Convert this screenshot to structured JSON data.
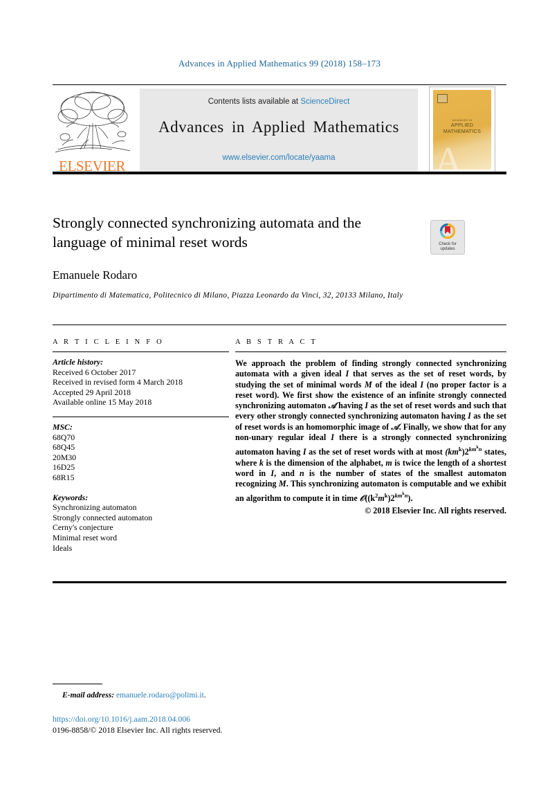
{
  "running_head": "Advances in Applied Mathematics 99 (2018) 158–173",
  "masthead": {
    "contents_prefix": "Contents lists available at ",
    "sciencedirect": "ScienceDirect",
    "journal_name": "Advances in Applied Mathematics",
    "journal_url": "www.elsevier.com/locate/yaama",
    "publisher_wordmark": "ELSEVIER",
    "cover": {
      "line1": "ADVANCES IN",
      "line2": "APPLIED",
      "line3": "MATHEMATICS",
      "big_letter": "A"
    },
    "colors": {
      "elsevier_orange": "#ee7624",
      "link_blue": "#2a7fb8",
      "contents_bg": "#e8e8e8",
      "cover_gold": "#e4b149"
    }
  },
  "article": {
    "title": "Strongly connected synchronizing automata and the language of minimal reset words",
    "author": "Emanuele Rodaro",
    "affiliation": "Dipartimento di Matematica, Politecnico di Milano, Piazza Leonardo da Vinci, 32, 20133 Milano, Italy",
    "crossmark": {
      "line1": "Check for",
      "line2": "updates"
    }
  },
  "info": {
    "heading": "A R T I C L E   I N F O",
    "history_label": "Article history:",
    "history": [
      "Received 6 October 2017",
      "Received in revised form 4 March 2018",
      "Accepted 29 April 2018",
      "Available online 15 May 2018"
    ],
    "msc_label": "MSC:",
    "msc": [
      "68Q70",
      "68Q45",
      "20M30",
      "16D25",
      "68R15"
    ],
    "keywords_label": "Keywords:",
    "keywords": [
      "Synchronizing automaton",
      "Strongly connected automaton",
      "Cerny's conjecture",
      "Minimal reset word",
      "Ideals"
    ]
  },
  "abstract": {
    "heading": "A B S T R A C T",
    "part1": "We approach the problem of finding strongly connected synchronizing automata with a given ideal ",
    "ideal_I": "I",
    "part2": " that serves as the set of reset words, by studying the set of minimal words ",
    "minimal_M": "M",
    "part3": " of the ideal ",
    "part4": " (no proper factor is a reset word). We first show the existence of an infinite strongly connected synchronizing automaton ",
    "automaton_A": "𝒜",
    "part5": " having ",
    "part6": " as the set of reset words and such that every other strongly connected synchronizing automaton having ",
    "part7": " as the set of reset words is an homomorphic image of ",
    "part8": ". Finally, we show that for any non-unary regular ideal ",
    "part9": " there is a strongly connected synchronizing automaton having ",
    "part10": " as the set of reset words with at most ",
    "formula_states_base": "(km",
    "formula_states_exp1": "k",
    "formula_states_mid": ")2",
    "formula_states_exp2": "km",
    "formula_states_exp2b": "k",
    "formula_states_exp2c": "n",
    "part11": " states, where ",
    "var_k": "k",
    "part12": " is the dimension of the alphabet, ",
    "var_m": "m",
    "part13": " is twice the length of a shortest word in ",
    "part14": ", and ",
    "var_n": "n",
    "part15": " is the number of states of the smallest automaton recognizing ",
    "part16": ". This synchronizing automaton is computable and we exhibit an algorithm to compute it in time ",
    "complexity_O": "𝒪",
    "complexity_base": "((k",
    "complexity_exp_2": "2",
    "complexity_m": "m",
    "complexity_exp_k": "k",
    "complexity_mid": ")2",
    "complexity_exp2": "km",
    "complexity_exp2b": "k",
    "complexity_exp2c": "n",
    "complexity_tail": ").",
    "copyright": "© 2018 Elsevier Inc. All rights reserved."
  },
  "footer": {
    "email_label": "E-mail address:",
    "email": "emanuele.rodaro@polimi.it",
    "email_period": ".",
    "doi": "https://doi.org/10.1016/j.aam.2018.04.006",
    "issn_line": "0196-8858/© 2018 Elsevier Inc. All rights reserved."
  }
}
